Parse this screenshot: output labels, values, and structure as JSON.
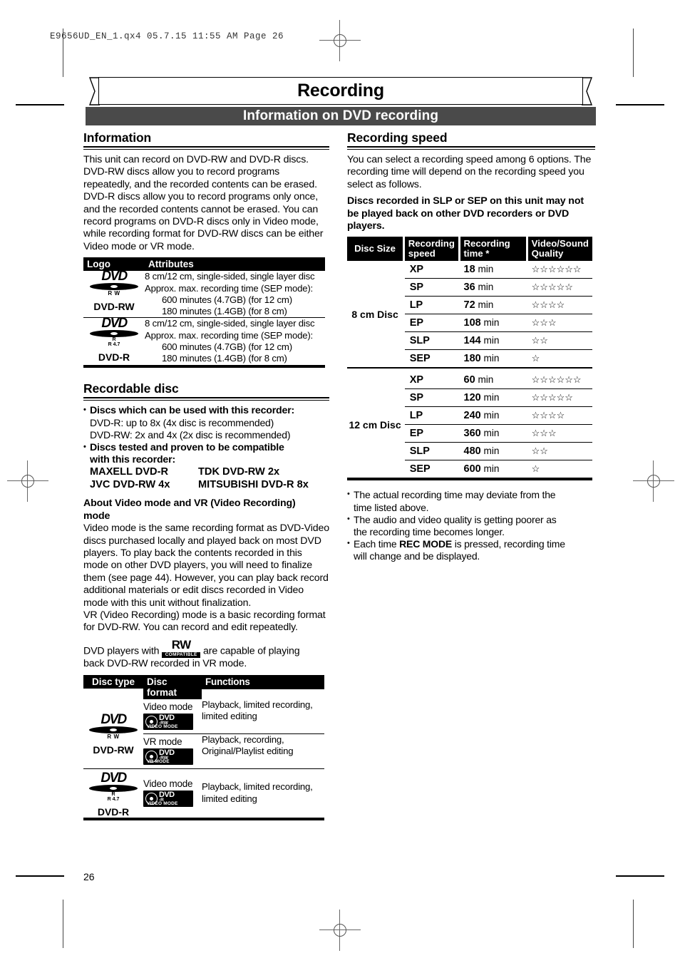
{
  "print_header": "E9656UD_EN_1.qx4   05.7.15   11:55 AM   Page 26",
  "title": "Recording",
  "section_bar": "Information on DVD recording",
  "page_number": "26",
  "left": {
    "information": {
      "heading": "Information",
      "paragraph": "This unit can record on DVD-RW and DVD-R discs. DVD-RW discs allow you to record programs repeatedly, and the recorded contents can be erased. DVD-R discs allow you to record programs only once, and the recorded contents cannot be erased. You can record programs on DVD-R discs only in Video mode, while recording format for DVD-RW discs can be either Video mode or VR mode.",
      "table": {
        "headers": [
          "Logo",
          "Attributes"
        ],
        "rows": [
          {
            "logo_name": "DVD-RW",
            "logo_sub": "R W",
            "attr_line1": "8 cm/12 cm, single-sided, single layer disc",
            "attr_line2": "Approx. max. recording time (SEP mode):",
            "attr_line3": "600 minutes (4.7GB) (for 12 cm)",
            "attr_line4": "180 minutes (1.4GB) (for 8 cm)"
          },
          {
            "logo_name": "DVD-R",
            "logo_sub": "R",
            "logo_sub2": "R 4.7",
            "attr_line1": "8 cm/12 cm, single-sided, single layer disc",
            "attr_line2": "Approx. max. recording time (SEP mode):",
            "attr_line3": "600 minutes (4.7GB) (for 12 cm)",
            "attr_line4": "180 minutes (1.4GB) (for 8 cm)"
          }
        ]
      }
    },
    "recordable": {
      "heading": "Recordable disc",
      "bullet1": "Discs which can be used with this recorder:",
      "speed_line1": "DVD-R:    up to 8x   (4x disc is recommended)",
      "speed_line2": "DVD-RW: 2x and 4x (2x disc is recommended)",
      "bullet2_l1": "Discs tested and proven to be compatible",
      "bullet2_l2": "with this recorder:",
      "brands": [
        [
          "MAXELL DVD-R",
          "TDK DVD-RW 2x"
        ],
        [
          "JVC DVD-RW 4x",
          "MITSUBISHI DVD-R 8x"
        ]
      ],
      "about_heading_l1": "About Video mode and VR (Video Recording)",
      "about_heading_l2": "mode",
      "about_body": "Video mode is the same recording format as DVD-Video discs purchased locally and played back on most DVD players. To play back the contents recorded in this mode on other DVD players, you will need to finalize them (see page 44). However, you can play back record additional materials or edit discs recorded in Video mode with this unit without finalization.",
      "vr_body": "VR (Video Recording) mode is a basic recording format for DVD-RW. You can record and edit repeatedly.",
      "rw_line_pre": "DVD players with",
      "rw_mark_top": "RW",
      "rw_mark_bottom": "COMPATIBLE",
      "rw_line_post": "are capable of playing",
      "rw_line2": "back DVD-RW recorded in VR mode."
    },
    "disc_table": {
      "headers": [
        "Disc type",
        "Disc format",
        "Functions"
      ],
      "rows": [
        {
          "disc_type": "DVD-RW",
          "logo_sub": "R W",
          "formats": [
            {
              "format": "Video mode",
              "badge_main": "DVD",
              "badge_sub": "-RW",
              "badge_mode": "VIDEO MODE",
              "functions_l1": "Playback, limited recording,",
              "functions_l2": "limited editing"
            },
            {
              "format": "VR mode",
              "badge_main": "DVD",
              "badge_sub": "-RW",
              "badge_mode": "VR MODE",
              "functions_l1": "Playback, recording,",
              "functions_l2": "Original/Playlist editing"
            }
          ]
        },
        {
          "disc_type": "DVD-R",
          "logo_sub": "R",
          "logo_sub2": "R 4.7",
          "formats": [
            {
              "format": "Video mode",
              "badge_main": "DVD",
              "badge_sub": "-R",
              "badge_mode": "VIDEO MODE",
              "functions_l1": "Playback, limited recording,",
              "functions_l2": "limited editing"
            }
          ]
        }
      ]
    }
  },
  "right": {
    "heading": "Recording speed",
    "paragraph": "You can select a recording speed among 6 options. The recording time will depend on the recording speed you select as follows.",
    "warning": "Discs recorded in SLP or SEP on this unit may not be played back on other DVD recorders or DVD players.",
    "table": {
      "headers": [
        "Disc Size",
        "Recording speed",
        "Recording time *",
        "Video/Sound Quality"
      ],
      "groups": [
        {
          "size": "8 cm Disc",
          "rows": [
            {
              "speed": "XP",
              "time_num": "18",
              "time_unit": "min",
              "stars": 6
            },
            {
              "speed": "SP",
              "time_num": "36",
              "time_unit": "min",
              "stars": 5
            },
            {
              "speed": "LP",
              "time_num": "72",
              "time_unit": "min",
              "stars": 4
            },
            {
              "speed": "EP",
              "time_num": "108",
              "time_unit": "min",
              "stars": 3
            },
            {
              "speed": "SLP",
              "time_num": "144",
              "time_unit": "min",
              "stars": 2
            },
            {
              "speed": "SEP",
              "time_num": "180",
              "time_unit": "min",
              "stars": 1
            }
          ]
        },
        {
          "size": "12 cm Disc",
          "rows": [
            {
              "speed": "XP",
              "time_num": "60",
              "time_unit": "min",
              "stars": 6
            },
            {
              "speed": "SP",
              "time_num": "120",
              "time_unit": "min",
              "stars": 5
            },
            {
              "speed": "LP",
              "time_num": "240",
              "time_unit": "min",
              "stars": 4
            },
            {
              "speed": "EP",
              "time_num": "360",
              "time_unit": "min",
              "stars": 3
            },
            {
              "speed": "SLP",
              "time_num": "480",
              "time_unit": "min",
              "stars": 2
            },
            {
              "speed": "SEP",
              "time_num": "600",
              "time_unit": "min",
              "stars": 1
            }
          ]
        }
      ]
    },
    "notes": [
      {
        "l1": "The actual recording time may deviate from the",
        "l2": "time listed above."
      },
      {
        "l1": "The audio and video quality is getting poorer as",
        "l2": "the recording time becomes longer."
      },
      {
        "pre": "Each time ",
        "strong": "REC MODE",
        "post": " is pressed, recording time",
        "l2": "will change and be displayed."
      }
    ]
  }
}
